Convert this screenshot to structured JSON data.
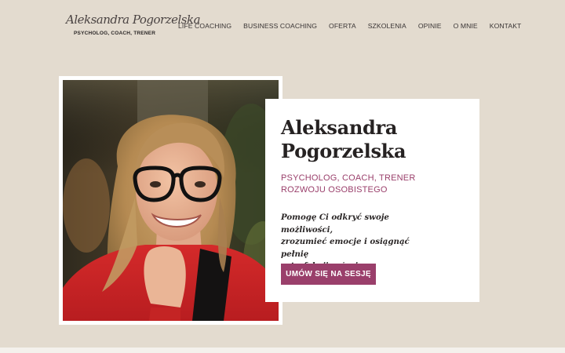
{
  "header": {
    "logo_script": "Aleksandra Pogorzelska",
    "logo_subtitle": "PSYCHOLOG, COACH, TRENER"
  },
  "nav": {
    "items": [
      {
        "label": "LIFE COACHING"
      },
      {
        "label": "BUSINESS COACHING"
      },
      {
        "label": "OFERTA"
      },
      {
        "label": "SZKOLENIA"
      },
      {
        "label": "OPINIE"
      },
      {
        "label": "O MNIE"
      },
      {
        "label": "KONTAKT"
      }
    ]
  },
  "hero": {
    "name_line1": "Aleksandra",
    "name_line2": "Pogorzelska",
    "subtitle_line1": "PSYCHOLOG, COACH, TRENER",
    "subtitle_line2": "ROZWOJU OSOBISTEGO",
    "tagline_line1": "Pomogę Ci odkryć swoje możliwości,",
    "tagline_line2": "zrozumieć emocje i osiągnąć pełnię",
    "tagline_line3": "satysfakcji w życiu.",
    "cta_label": "UMÓW SIĘ NA SESJĘ"
  },
  "colors": {
    "background": "#e3dbcf",
    "accent": "#9a3f6b",
    "card": "#ffffff",
    "text_dark": "#262222"
  }
}
